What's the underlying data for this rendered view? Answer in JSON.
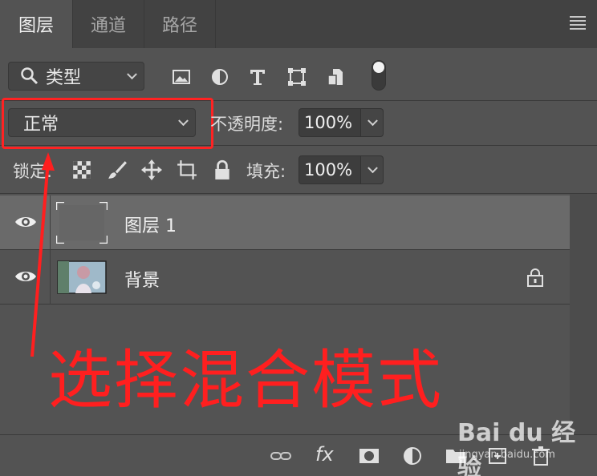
{
  "tabs": [
    {
      "label": "图层",
      "active": true
    },
    {
      "label": "通道",
      "active": false
    },
    {
      "label": "路径",
      "active": false
    }
  ],
  "filter": {
    "label": "类型",
    "icons": [
      "search-icon",
      "image-filter-icon",
      "adjustment-filter-icon",
      "type-filter-icon",
      "shape-filter-icon",
      "smart-object-filter-icon"
    ]
  },
  "blend": {
    "mode": "正常",
    "opacity_label": "不透明度:",
    "opacity": "100%"
  },
  "lock": {
    "label": "锁定:",
    "fill_label": "填充:",
    "fill": "100%",
    "icons": [
      "lock-transparent-icon",
      "lock-brush-icon",
      "lock-position-icon",
      "lock-artboard-icon",
      "lock-all-icon"
    ]
  },
  "layers": [
    {
      "name": "图层 1",
      "selected": true,
      "visible": true
    },
    {
      "name": "背景",
      "selected": false,
      "visible": true,
      "locked": true
    }
  ],
  "annotation": "选择混合模式",
  "bottom_icons": [
    "link-icon",
    "fx-icon",
    "mask-icon",
    "adjustment-icon",
    "folder-icon",
    "new-layer-icon",
    "trash-icon"
  ],
  "bottom_fx_label": "fx",
  "watermark": {
    "brand": "Bai du 经验",
    "sub": "jingyan.baidu.com"
  },
  "colors": {
    "accent_red": "#ff1f1f",
    "panel_bg": "#535353",
    "tab_bg": "#424242",
    "selected_row": "#6a6a6a"
  }
}
